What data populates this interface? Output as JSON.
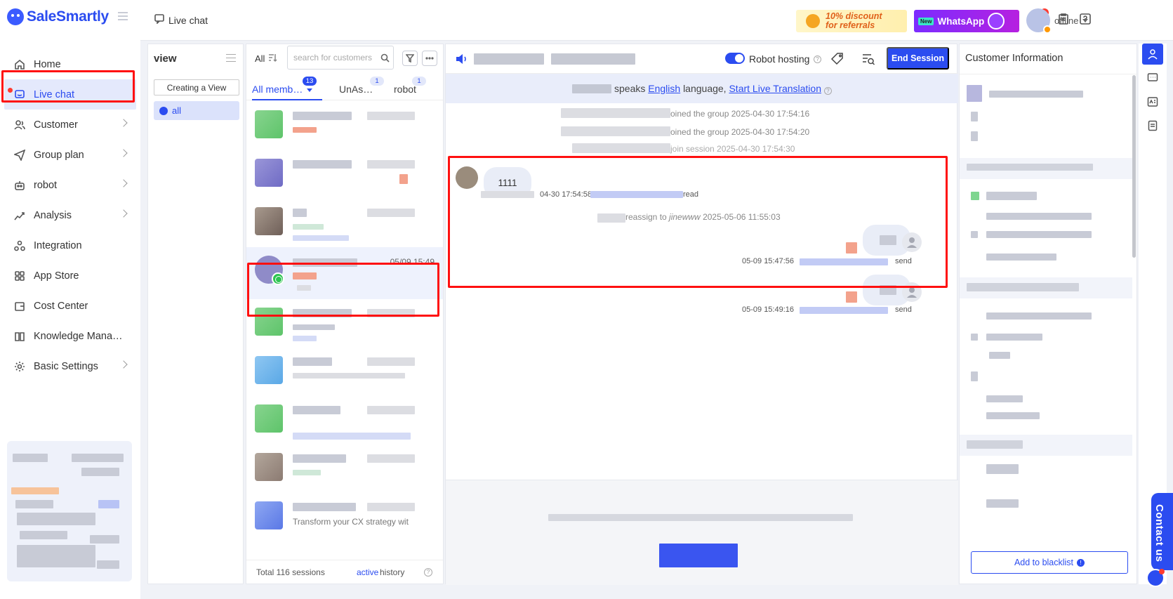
{
  "app": {
    "name": "SaleSmartly"
  },
  "colors": {
    "accent": "#2b4cf0",
    "highlight": "#ff1010",
    "whatsapp": "#2ec451"
  },
  "sidebar": {
    "items": [
      {
        "label": "Home",
        "icon": "home-icon",
        "has_chevron": false
      },
      {
        "label": "Live chat",
        "icon": "chat-icon",
        "has_chevron": false,
        "active": true
      },
      {
        "label": "Customer",
        "icon": "users-icon",
        "has_chevron": true
      },
      {
        "label": "Group plan",
        "icon": "send-icon",
        "has_chevron": true
      },
      {
        "label": "robot",
        "icon": "robot-icon",
        "has_chevron": true
      },
      {
        "label": "Analysis",
        "icon": "chart-icon",
        "has_chevron": true
      },
      {
        "label": "Integration",
        "icon": "integration-icon",
        "has_chevron": false
      },
      {
        "label": "App Store",
        "icon": "grid-icon",
        "has_chevron": false
      },
      {
        "label": "Cost Center",
        "icon": "wallet-icon",
        "has_chevron": false
      },
      {
        "label": "Knowledge Mana…",
        "icon": "book-icon",
        "has_chevron": false
      },
      {
        "label": "Basic Settings",
        "icon": "gear-icon",
        "has_chevron": true
      }
    ]
  },
  "header": {
    "title": "Live chat",
    "promo_line1": "10% discount",
    "promo_line2": "for referrals",
    "wa_new": "New",
    "wa_label": "WhatsApp",
    "notif_badge": "···",
    "user_status": "offline"
  },
  "view_panel": {
    "title": "view",
    "create_label": "Creating a View",
    "all_label": "all"
  },
  "sessions_panel": {
    "filter_label": "All",
    "search_placeholder": "search for customers",
    "tabs": [
      {
        "label": "All memb…",
        "badge": "13"
      },
      {
        "label": "UnAs…",
        "badge": "1"
      },
      {
        "label": "robot",
        "badge": "1"
      }
    ],
    "selected_time": "05/09 15:49",
    "last_preview": "Transform your CX strategy wit",
    "total": "Total 116 sessions",
    "tab_active": "active",
    "tab_history": "history"
  },
  "chat": {
    "robot_hosting": "Robot hosting",
    "end_session": "End Session",
    "translate_speaks": "speaks",
    "translate_lang": "English",
    "translate_mid": "language,",
    "translate_link": "Start Live Translation",
    "sys1": "oined the group 2025-04-30 17:54:16",
    "sys2": "oined the group 2025-04-30 17:54:20",
    "sys3": "join session 2025-04-30 17:54:30",
    "incoming_text": "1111",
    "incoming_time": "04-30 17:54:58",
    "incoming_status": "read",
    "reassign_mid": "reassign to",
    "reassign_user": "jinewww",
    "reassign_time": "2025-05-06 11:55:03",
    "out1_time": "05-09 15:47:56",
    "out1_status": "send",
    "out2_time": "05-09 15:49:16",
    "out2_status": "send"
  },
  "customer_panel": {
    "title": "Customer Information",
    "blacklist_label": "Add to blacklist"
  },
  "contact": {
    "label": "Contact us"
  }
}
